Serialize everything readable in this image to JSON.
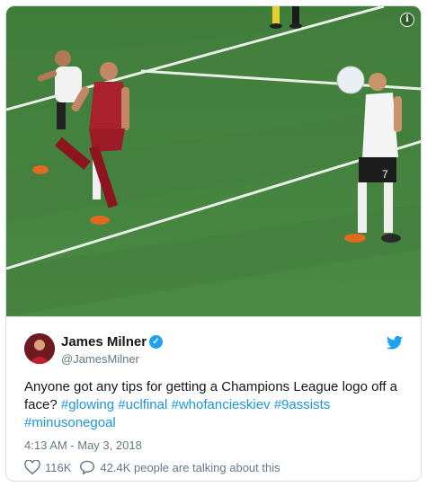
{
  "media": {
    "info_icon": "info-icon",
    "jersey_number": "7"
  },
  "tweet": {
    "display_name": "James Milner",
    "verified_icon": "verified-badge-icon",
    "verified_mark": "✓",
    "handle": "@JamesMilner",
    "text_plain": "Anyone got any tips for getting a Champions League logo off a face?",
    "hashtags": [
      "#glowing",
      "#uclfinal",
      "#whofancieskiev",
      "#9assists",
      "#minusonegoal"
    ],
    "timestamp": "4:13 AM - May 3, 2018",
    "likes": "116K",
    "replies_text": "42.4K people are talking about this",
    "colors": {
      "link": "#1b95e0",
      "verified": "#1da1f2",
      "muted": "#657786"
    }
  }
}
